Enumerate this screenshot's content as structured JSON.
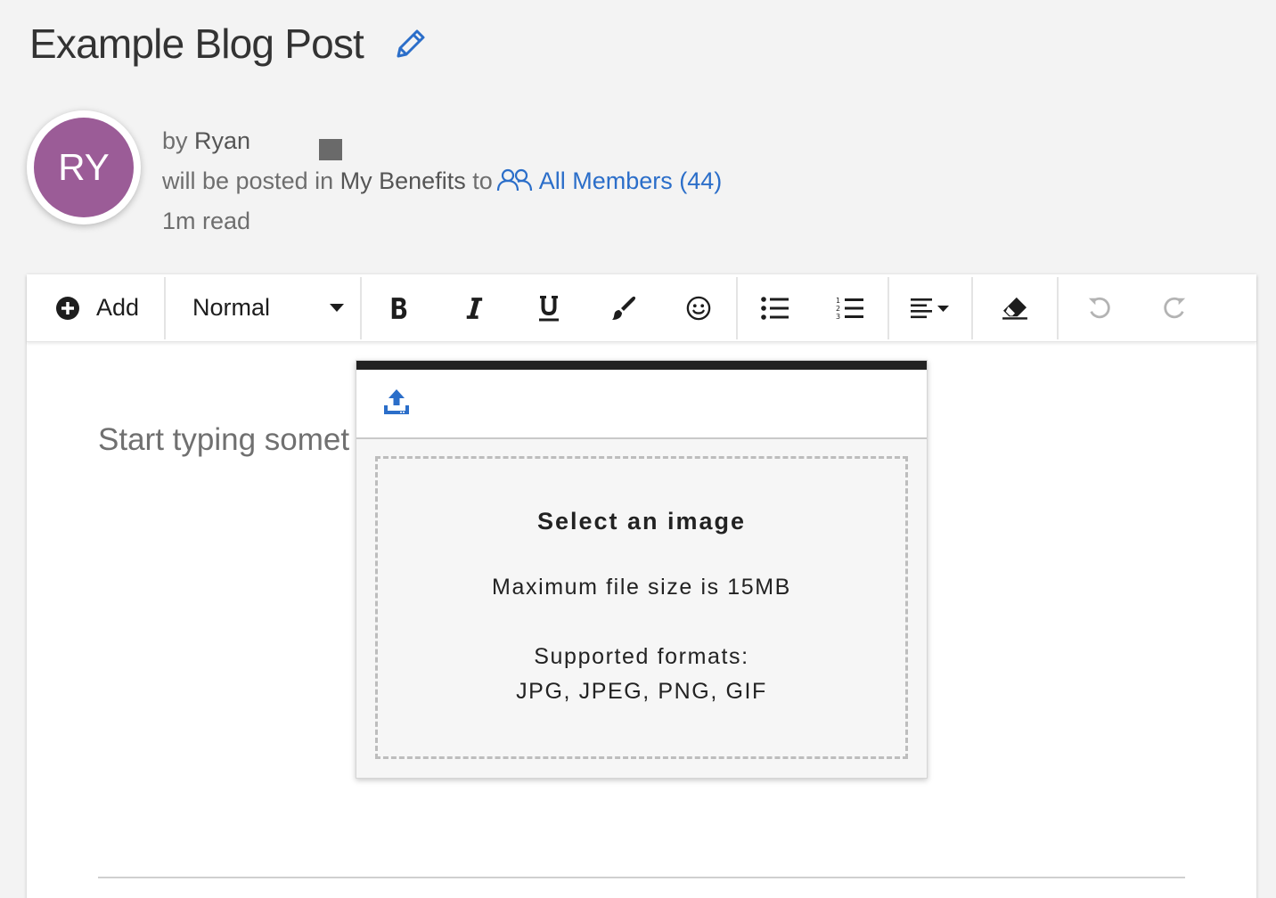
{
  "header": {
    "title": "Example Blog Post"
  },
  "author": {
    "initials": "RY",
    "by_prefix": "by",
    "name": "Ryan",
    "posted_prefix": "will be posted in",
    "channel": "My Benefits",
    "to_text": "to",
    "audience": "All Members (44)",
    "read_time": "1m read"
  },
  "toolbar": {
    "add_label": "Add",
    "style_value": "Normal"
  },
  "editor": {
    "placeholder": "Start typing somet"
  },
  "image_popup": {
    "title": "Select an image",
    "max_size": "Maximum file size is 15MB",
    "formats_label": "Supported formats:",
    "formats": "JPG, JPEG, PNG, GIF"
  },
  "colors": {
    "avatar": "#9b5c97",
    "link": "#2b6ec9",
    "background": "#f3f3f3"
  }
}
